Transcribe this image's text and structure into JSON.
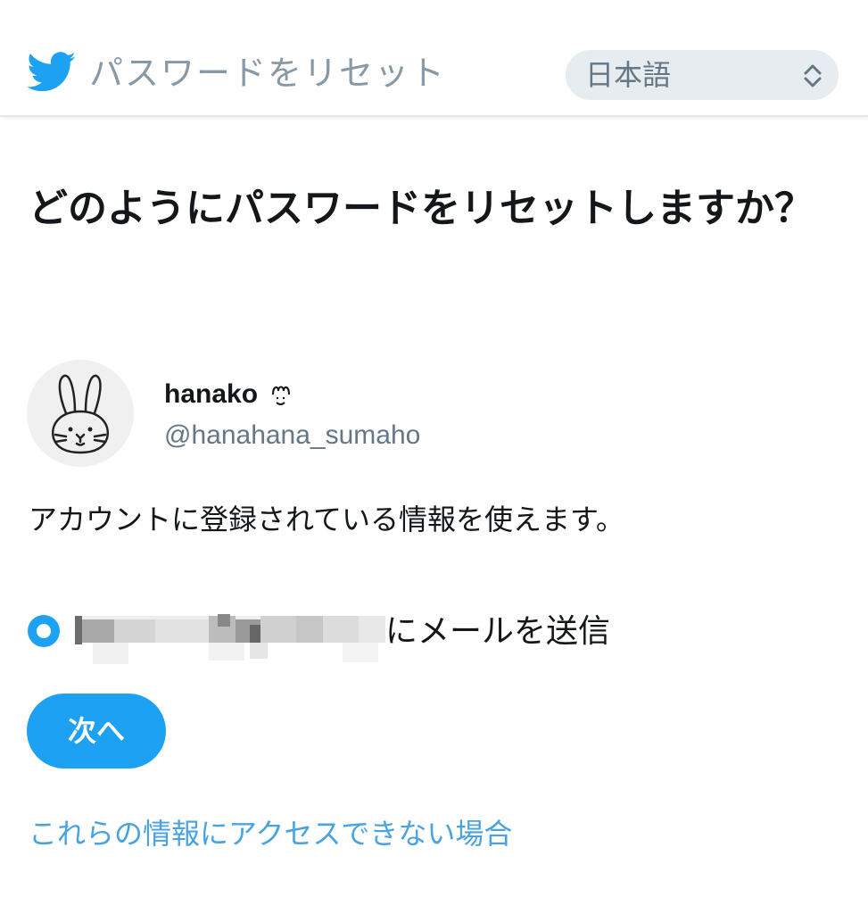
{
  "header": {
    "logo_icon": "twitter-bird-icon",
    "title": "パスワードをリセット",
    "language_select": {
      "selected": "日本語",
      "icon": "chevron-updown-icon"
    }
  },
  "main": {
    "heading": "どのようにパスワードをリセットしますか？",
    "account": {
      "display_name": "hanako",
      "handle": "@hanahana_sumaho",
      "avatar_icon": "rabbit-avatar"
    },
    "info_text": "アカウントに登録されている情報を使えます。",
    "option": {
      "label_suffix": "にメールを送信",
      "selected": true
    },
    "next_button": "次へ",
    "help_link": "これらの情報にアクセスできない場合"
  },
  "colors": {
    "brand_blue": "#1da1f2",
    "link_blue": "#4aa3df",
    "muted_text": "#657786",
    "header_title": "#8899a6",
    "select_bg": "#e6ecf0"
  }
}
